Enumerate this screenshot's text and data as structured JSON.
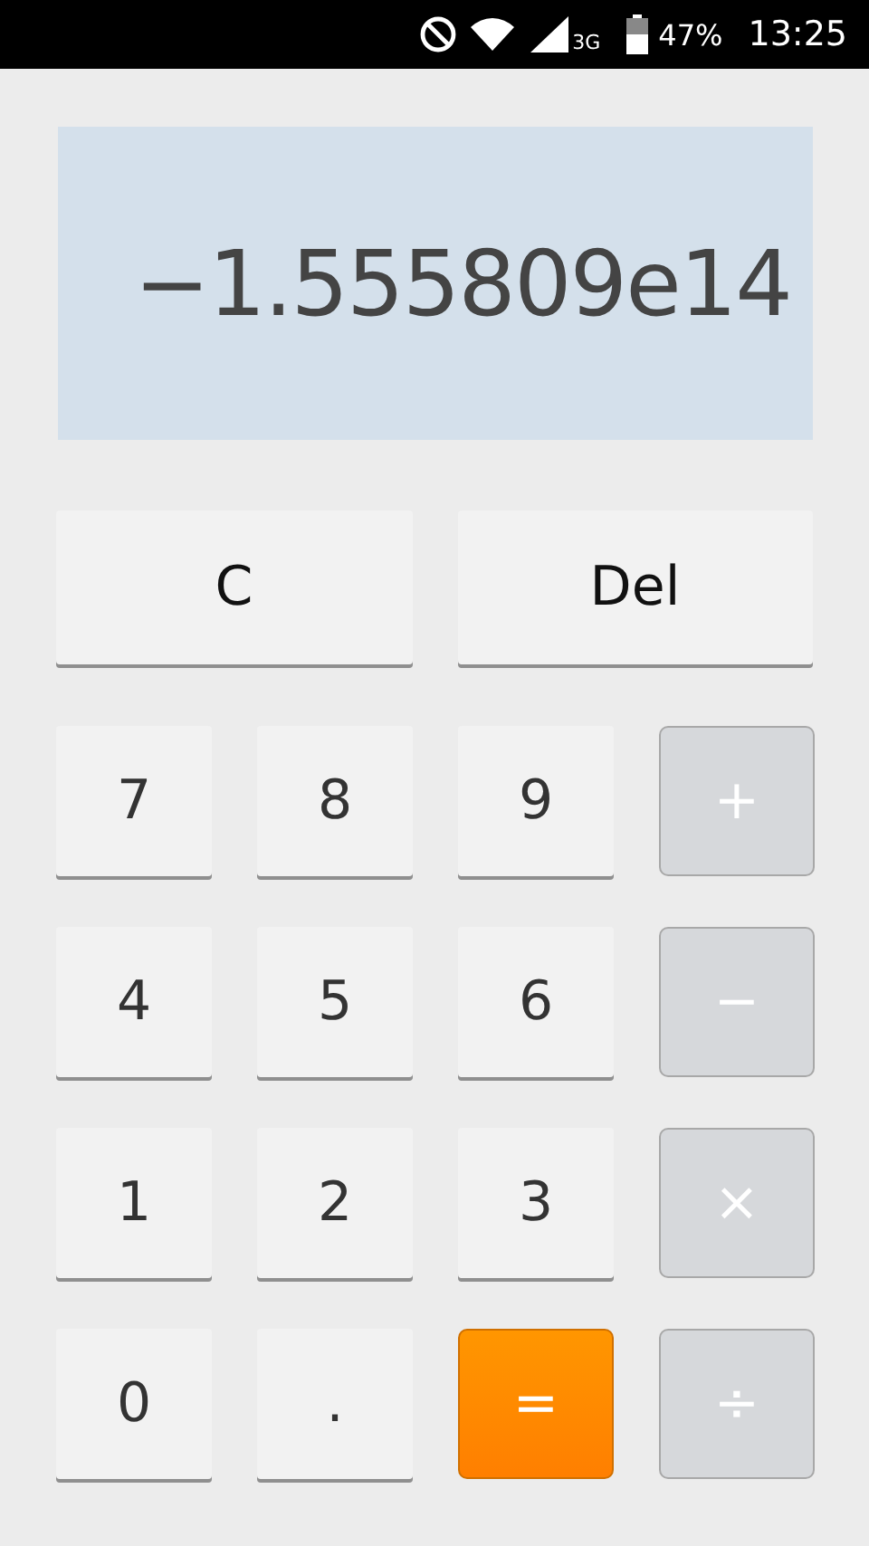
{
  "status_bar": {
    "network": "3G",
    "battery": "47%",
    "time": "13:25"
  },
  "display": {
    "value": "−1.555809e14"
  },
  "top_buttons": [
    "C",
    "Del"
  ],
  "keys": [
    {
      "label": "7",
      "kind": "digit"
    },
    {
      "label": "8",
      "kind": "digit"
    },
    {
      "label": "9",
      "kind": "digit"
    },
    {
      "label": "+",
      "kind": "operator"
    },
    {
      "label": "4",
      "kind": "digit"
    },
    {
      "label": "5",
      "kind": "digit"
    },
    {
      "label": "6",
      "kind": "digit"
    },
    {
      "label": "−",
      "kind": "operator"
    },
    {
      "label": "1",
      "kind": "digit"
    },
    {
      "label": "2",
      "kind": "digit"
    },
    {
      "label": "3",
      "kind": "digit"
    },
    {
      "label": "×",
      "kind": "operator"
    },
    {
      "label": "0",
      "kind": "digit"
    },
    {
      "label": ".",
      "kind": "digit"
    },
    {
      "label": "=",
      "kind": "equals"
    },
    {
      "label": "÷",
      "kind": "operator"
    }
  ]
}
